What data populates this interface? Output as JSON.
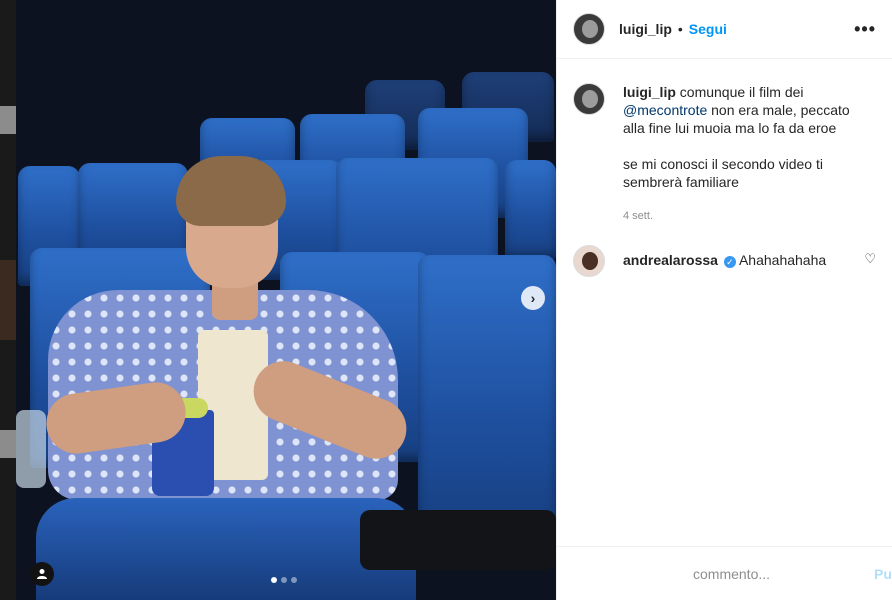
{
  "post": {
    "author": "luigi_lip",
    "follow_label": "Segui",
    "separator": "•",
    "more_icon": "more-horizontal-icon",
    "carousel": {
      "total_slides": 3,
      "active_slide": 1
    }
  },
  "caption": {
    "username": "luigi_lip",
    "text_before": "comunque il film dei",
    "mention": "@mecontrote",
    "text_after": "non era male, peccato alla fine lui muoia ma lo fa da eroe",
    "paragraph2": "se mi conosci il secondo video ti sembrerà familiare",
    "timestamp": "4 sett."
  },
  "comments": [
    {
      "username": "andrealarossa",
      "verified": true,
      "text": "Ahahahahaha"
    }
  ],
  "composer": {
    "placeholder": "commento...",
    "publish_label": "Pubblica"
  },
  "colors": {
    "link_blue": "#0095f6",
    "publish_disabled": "#b2dffc",
    "verified_blue": "#3897f0"
  }
}
